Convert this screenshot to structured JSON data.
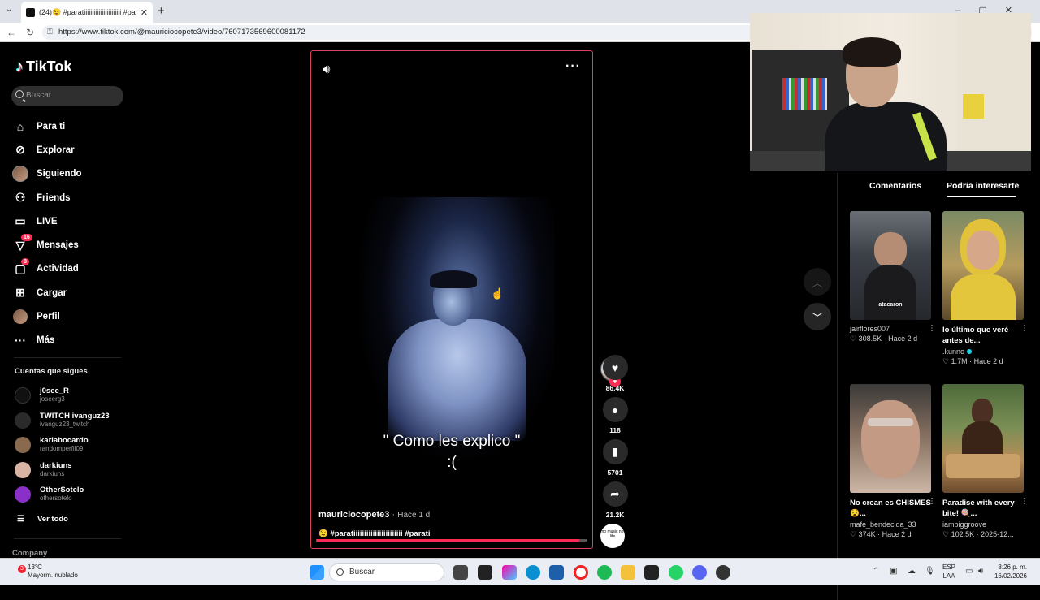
{
  "browser": {
    "tab_title": "(24)😉 #paratiiiiiiiiiiiiiiiiiiiiiii #pa",
    "url": "https://www.tiktok.com/@mauriciocopete3/video/7607173569600081172"
  },
  "sidebar": {
    "logo": "TikTok",
    "search_placeholder": "Buscar",
    "nav": [
      {
        "label": "Para ti",
        "icon": "home-icon"
      },
      {
        "label": "Explorar",
        "icon": "compass-icon"
      },
      {
        "label": "Siguiendo",
        "icon": "avatar"
      },
      {
        "label": "Friends",
        "icon": "friends-icon"
      },
      {
        "label": "LIVE",
        "icon": "live-icon"
      },
      {
        "label": "Mensajes",
        "icon": "messages-icon",
        "badge": "16"
      },
      {
        "label": "Actividad",
        "icon": "activity-icon",
        "badge": "8"
      },
      {
        "label": "Cargar",
        "icon": "upload-icon"
      },
      {
        "label": "Perfil",
        "icon": "profile-avatar"
      },
      {
        "label": "Más",
        "icon": "more-icon"
      }
    ],
    "following_title": "Cuentas que sigues",
    "following": [
      {
        "name": "j0see_R",
        "user": "joseerg3",
        "color": "#111111"
      },
      {
        "name": "TWITCH ivanguz23",
        "user": "ivanguz23_twitch",
        "color": "#2a2a2a"
      },
      {
        "name": "karlabocardo",
        "user": "randomperfil09",
        "color": "#8a6a4e"
      },
      {
        "name": "darkiuns",
        "user": "darkiuns",
        "color": "#d9b3a3"
      },
      {
        "name": "OtherSotelo",
        "user": "othersotelo",
        "color": "#8b2fc9"
      }
    ],
    "see_all": "Ver todo",
    "company": "Company"
  },
  "video": {
    "caption_line1": "\" Como les explico \"",
    "caption_line2": ":(",
    "author": "mauriciocopete3",
    "separator": "·",
    "time": "Hace 1 d",
    "description": "😉 #paratiiiiiiiiiiiiiiiiiiiiiii #parati",
    "progress": 0.97
  },
  "actions": {
    "likes": "86.4K",
    "comments": "118",
    "saves": "5701",
    "shares": "21.2K",
    "music_label": "no music no life"
  },
  "right": {
    "tabs": [
      "Comentarios",
      "Podría interesarte"
    ],
    "cards": [
      {
        "title": "",
        "user": "jairflores007",
        "likes": "308.5K",
        "time": "Hace 2 d",
        "thumb_caption": "atacaron",
        "verified": false
      },
      {
        "title": "lo último que veré antes de...",
        "user": ".kunno",
        "likes": "1.7M",
        "time": "Hace 2 d",
        "thumb_caption": "",
        "verified": true
      },
      {
        "title": "No crean es CHISMES😵...",
        "user": "mafe_bendecida_33",
        "likes": "374K",
        "time": "Hace 2 d",
        "thumb_caption": "",
        "verified": false
      },
      {
        "title": "Paradise with every bite! 🍭...",
        "user": "iambiggroove",
        "likes": "102.5K",
        "time": "2025-12...",
        "thumb_caption": "",
        "verified": false
      }
    ]
  },
  "taskbar": {
    "weather_temp": "13°C",
    "weather_desc": "Mayorm. nublado",
    "weather_badge": "3",
    "search": "Buscar",
    "lang1": "ESP",
    "lang2": "LAA",
    "time": "8:26 p. m.",
    "date": "16/02/2026"
  }
}
